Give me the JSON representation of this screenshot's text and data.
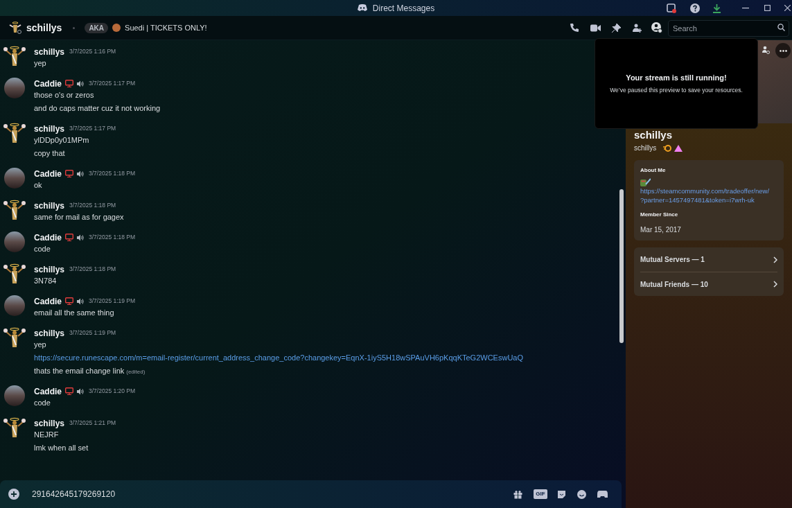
{
  "window": {
    "title": "Direct Messages"
  },
  "header": {
    "name": "schillys",
    "aka_label": "AKA",
    "aka_name": "Suedi | TICKETS ONLY!",
    "search": {
      "placeholder": "Search"
    }
  },
  "messages": [
    {
      "author": "schillys",
      "kind": "angel",
      "streaming": false,
      "in_voice": false,
      "time": "3/7/2025 1:16 PM",
      "lines": [
        {
          "kind": "text",
          "text": "yep"
        }
      ]
    },
    {
      "author": "Caddie",
      "kind": "round",
      "streaming": true,
      "in_voice": true,
      "time": "3/7/2025 1:17 PM",
      "lines": [
        {
          "kind": "text",
          "text": "those o's or zeros"
        },
        {
          "kind": "text",
          "text": "and do caps matter cuz it not working"
        }
      ]
    },
    {
      "author": "schillys",
      "kind": "angel",
      "streaming": false,
      "in_voice": false,
      "time": "3/7/2025 1:17 PM",
      "lines": [
        {
          "kind": "text",
          "text": "ylDDp0y01MPm"
        },
        {
          "kind": "text",
          "text": "copy that"
        }
      ]
    },
    {
      "author": "Caddie",
      "kind": "round",
      "streaming": true,
      "in_voice": true,
      "time": "3/7/2025 1:18 PM",
      "lines": [
        {
          "kind": "text",
          "text": "ok"
        }
      ]
    },
    {
      "author": "schillys",
      "kind": "angel",
      "streaming": false,
      "in_voice": false,
      "time": "3/7/2025 1:18 PM",
      "lines": [
        {
          "kind": "text",
          "text": "same for mail as for gagex"
        }
      ]
    },
    {
      "author": "Caddie",
      "kind": "round",
      "streaming": true,
      "in_voice": true,
      "time": "3/7/2025 1:18 PM",
      "lines": [
        {
          "kind": "text",
          "text": "code"
        }
      ]
    },
    {
      "author": "schillys",
      "kind": "angel",
      "streaming": false,
      "in_voice": false,
      "time": "3/7/2025 1:18 PM",
      "lines": [
        {
          "kind": "text",
          "text": "3N784"
        }
      ]
    },
    {
      "author": "Caddie",
      "kind": "round",
      "streaming": true,
      "in_voice": true,
      "time": "3/7/2025 1:19 PM",
      "lines": [
        {
          "kind": "text",
          "text": "email all the same thing"
        }
      ]
    },
    {
      "author": "schillys",
      "kind": "angel",
      "streaming": false,
      "in_voice": false,
      "time": "3/7/2025 1:19 PM",
      "lines": [
        {
          "kind": "text",
          "text": "yep"
        },
        {
          "kind": "link",
          "text": "https://secure.runescape.com/m=email-register/current_address_change_code?changekey=EqnX-1iyS5H18wSPAuVH6pKqqKTeG2WCEswUaQ"
        },
        {
          "kind": "text",
          "text": "thats the email change link",
          "edited": "(edited)"
        }
      ]
    },
    {
      "author": "Caddie",
      "kind": "round",
      "streaming": true,
      "in_voice": true,
      "time": "3/7/2025 1:20 PM",
      "lines": [
        {
          "kind": "text",
          "text": "code"
        }
      ]
    },
    {
      "author": "schillys",
      "kind": "angel",
      "streaming": false,
      "in_voice": false,
      "time": "3/7/2025 1:21 PM",
      "lines": [
        {
          "kind": "text",
          "text": "NEJRF"
        },
        {
          "kind": "text",
          "text": "lmk when all set"
        }
      ]
    }
  ],
  "composer": {
    "value": "291642645179269120",
    "gif_label": "GIF"
  },
  "stream_notice": {
    "title": "Your stream is still running!",
    "text": "We’ve paused this preview to save your resources."
  },
  "profile": {
    "display_name": "schillys",
    "username": "schillys",
    "about_heading": "About Me",
    "about_link_1": "https://steamcommunity.com/tradeoffer/new/",
    "about_link_2": "?partner=1457497481&token=i7wrh-uk",
    "member_heading": "Member Since",
    "member_since": "Mar 15, 2017",
    "mutuals": [
      "Mutual Servers — 1",
      "Mutual Friends — 10"
    ]
  }
}
